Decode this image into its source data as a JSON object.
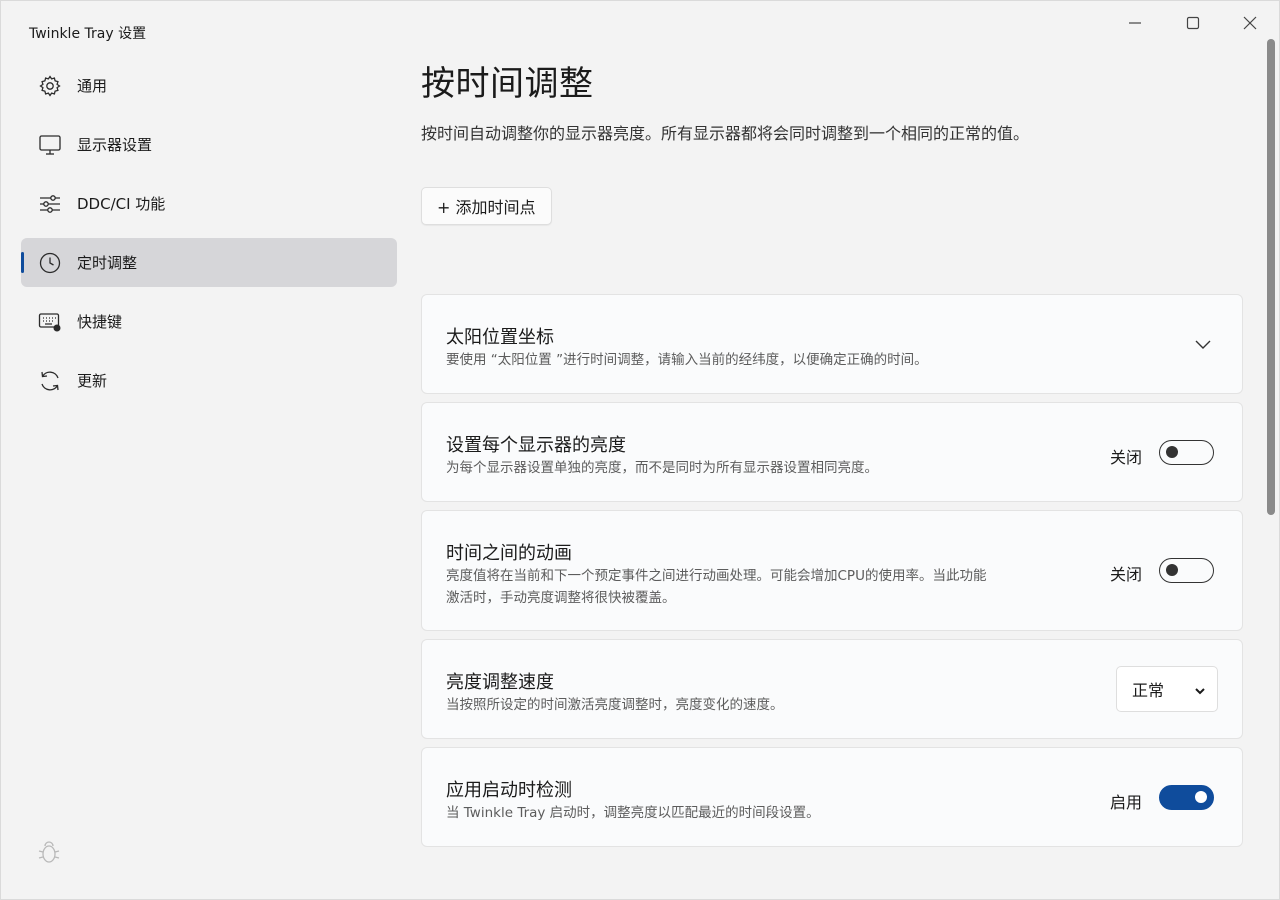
{
  "window": {
    "title": "Twinkle Tray 设置"
  },
  "sidebar": {
    "items": [
      {
        "label": "通用",
        "icon": "gear-icon"
      },
      {
        "label": "显示器设置",
        "icon": "monitor-icon"
      },
      {
        "label": "DDC/CI 功能",
        "icon": "sliders-icon"
      },
      {
        "label": "定时调整",
        "icon": "clock-icon",
        "active": true
      },
      {
        "label": "快捷键",
        "icon": "keyboard-icon"
      },
      {
        "label": "更新",
        "icon": "refresh-icon"
      }
    ]
  },
  "main": {
    "title": "按时间调整",
    "description": "按时间自动调整你的显示器亮度。所有显示器都将会同时调整到一个相同的正常的值。",
    "add_button": "+ 添加时间点"
  },
  "cards": {
    "sun": {
      "title": "太阳位置坐标",
      "desc": "要使用 “太阳位置 ”进行时间调整，请输入当前的经纬度，以便确定正确的时间。"
    },
    "per_monitor": {
      "title": "设置每个显示器的亮度",
      "desc": "为每个显示器设置单独的亮度，而不是同时为所有显示器设置相同亮度。",
      "state_label": "关闭",
      "on": false
    },
    "animate": {
      "title": "时间之间的动画",
      "desc_line1": "亮度值将在当前和下一个预定事件之间进行动画处理。可能会增加CPU的使用率。当此功能",
      "desc_line2": "激活时，手动亮度调整将很快被覆盖。",
      "state_label": "关闭",
      "on": false
    },
    "speed": {
      "title": "亮度调整速度",
      "desc": "当按照所设定的时间激活亮度调整时，亮度变化的速度。",
      "selected": "正常"
    },
    "startup": {
      "title": "应用启动时检测",
      "desc": "当 Twinkle Tray 启动时，调整亮度以匹配最近的时间段设置。",
      "state_label": "启用",
      "on": true
    }
  },
  "colors": {
    "accent": "#0f4c9c",
    "background": "#f3f3f3",
    "card": "#fafbfc"
  }
}
